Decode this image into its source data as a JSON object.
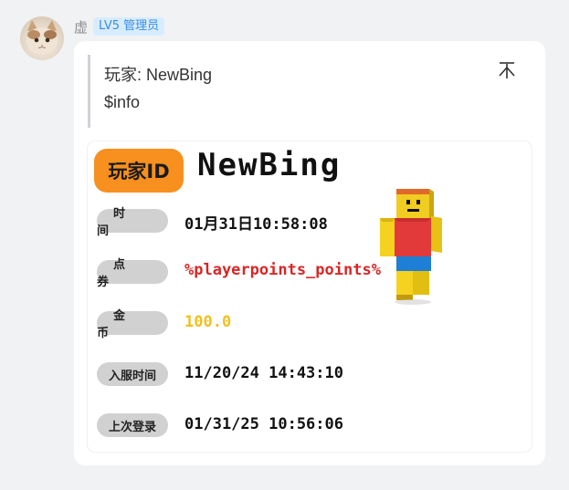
{
  "message": {
    "sender_name": "虚",
    "level_badge": "LV5 管理员",
    "quote": {
      "title": "玩家: NewBing",
      "info": "$info"
    },
    "card": {
      "id_label": "玩家ID",
      "player_name": "NewBing",
      "rows": [
        {
          "label": "时间",
          "value": "01月31日10:58:08"
        },
        {
          "label": "点券",
          "value": "%playerpoints_points%"
        },
        {
          "label": "金币",
          "value": "100.0"
        },
        {
          "label": "入服时间",
          "value": "11/20/24 14:43:10"
        },
        {
          "label": "上次登录",
          "value": "01/31/25 10:56:06"
        }
      ]
    }
  },
  "colors": {
    "badge_orange": "#f7901e",
    "points_red": "#d92626",
    "gold_yellow": "#f2c01e",
    "level_badge_blue": "#3a8ee6"
  },
  "icons": {
    "pin": "pin-top-icon",
    "avatar": "cat-avatar",
    "skin": "minecraft-skin-figure"
  }
}
